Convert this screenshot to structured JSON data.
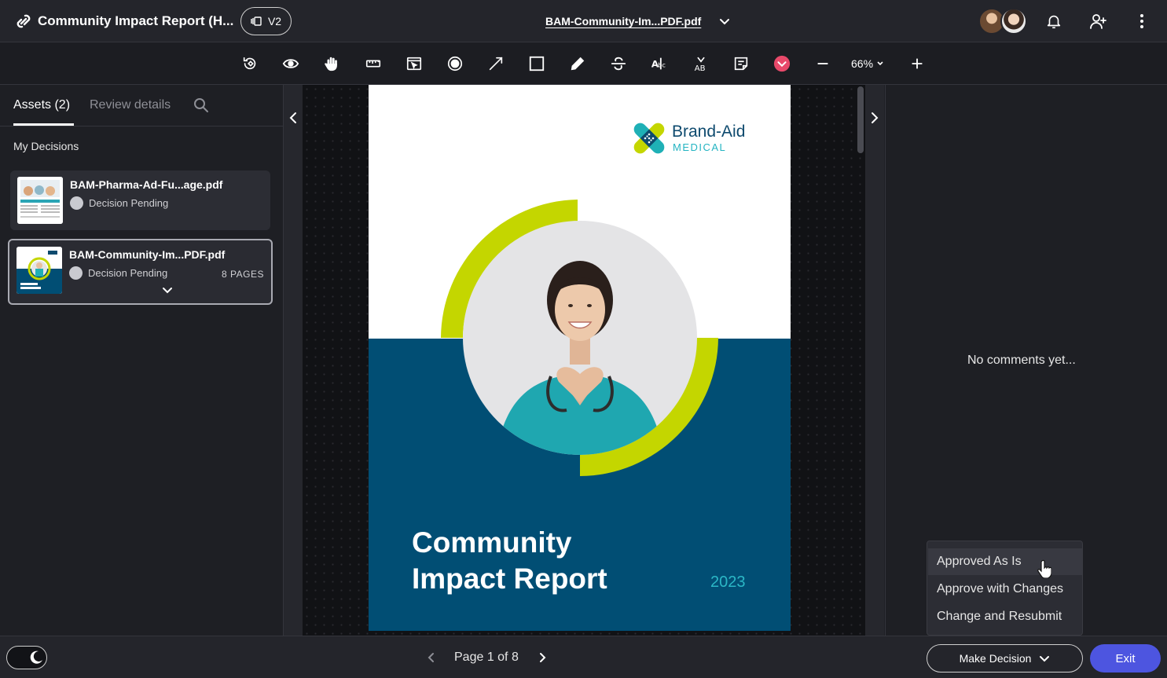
{
  "header": {
    "app_title": "Community Impact Report (H...",
    "version_label": "V2",
    "file_title": "BAM-Community-Im...PDF.pdf",
    "icons": [
      "link-icon",
      "versions-icon",
      "chevron-down-icon",
      "bell-icon",
      "add-user-icon",
      "more-vertical-icon"
    ]
  },
  "toolbar": {
    "tools": [
      "rotate-icon",
      "eye-icon",
      "hand-icon",
      "ruler-icon",
      "select-area-icon",
      "record-icon",
      "arrow-line-icon",
      "rectangle-icon",
      "pen-icon",
      "strikethrough-icon",
      "text-replace-icon",
      "text-insert-icon",
      "note-icon",
      "color-picker-icon"
    ],
    "zoom_label": "66%",
    "accent_color": "#e8496a"
  },
  "left_panel": {
    "tab_assets": "Assets (2)",
    "tab_review": "Review details",
    "section_label": "My Decisions",
    "assets": [
      {
        "name": "BAM-Pharma-Ad-Fu...age.pdf",
        "status": "Decision Pending",
        "pages": ""
      },
      {
        "name": "BAM-Community-Im...PDF.pdf",
        "status": "Decision Pending",
        "pages": "8 PAGES"
      }
    ]
  },
  "document": {
    "brand_name": "Brand-Aid",
    "brand_sub": "MEDICAL",
    "title_line1": "Community",
    "title_line2": "Impact Report",
    "year": "2023",
    "colors": {
      "blue": "#014e74",
      "lime": "#c4d600",
      "teal": "#2bb7c6"
    }
  },
  "right_panel": {
    "empty_text": "No comments yet..."
  },
  "decision_menu": {
    "options": [
      "Approved As Is",
      "Approve with Changes",
      "Change and Resubmit"
    ]
  },
  "footer": {
    "page_label": "Page 1 of 8",
    "make_decision_label": "Make Decision",
    "exit_label": "Exit",
    "exit_color": "#4d55e0"
  }
}
